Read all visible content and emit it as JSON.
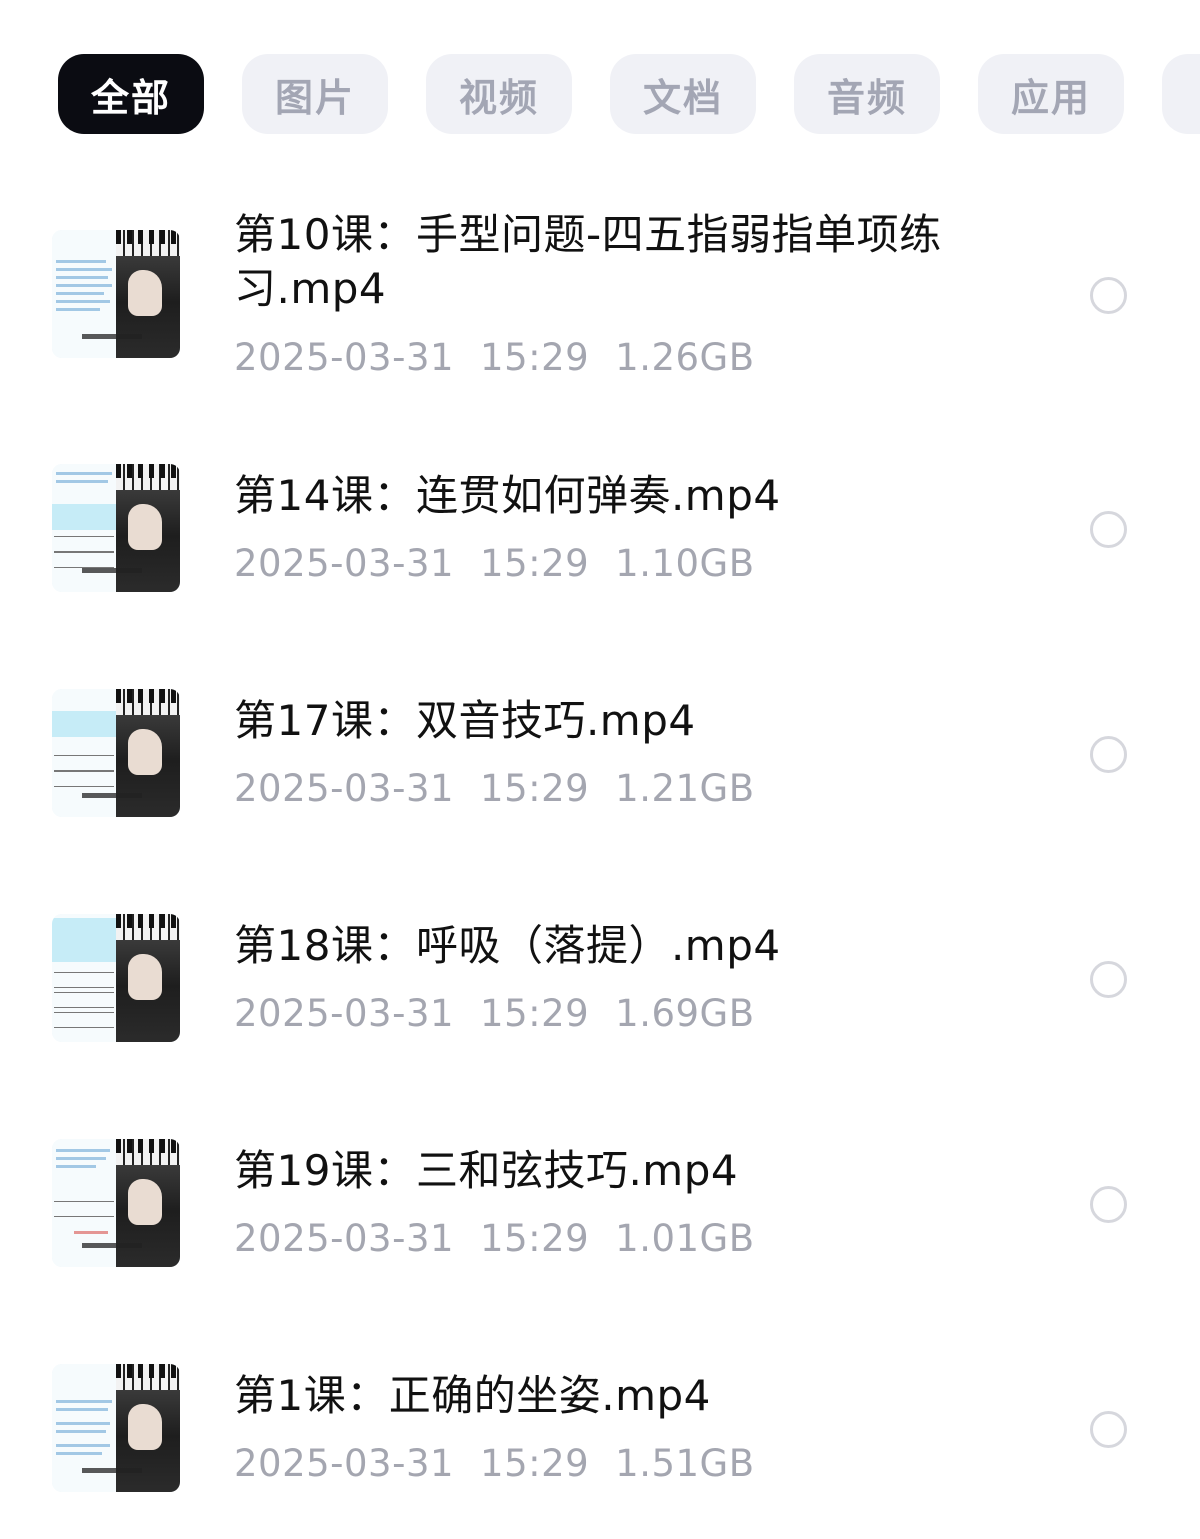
{
  "tabs": [
    {
      "label": "全部",
      "active": true
    },
    {
      "label": "图片",
      "active": false
    },
    {
      "label": "视频",
      "active": false
    },
    {
      "label": "文档",
      "active": false
    },
    {
      "label": "音频",
      "active": false
    },
    {
      "label": "应用",
      "active": false
    }
  ],
  "files": [
    {
      "name": "第10课：手型问题-四五指弱指单项练习.mp4",
      "date": "2025-03-31",
      "time": "15:29",
      "size": "1.26GB",
      "selected": false
    },
    {
      "name": "第14课：连贯如何弹奏.mp4",
      "date": "2025-03-31",
      "time": "15:29",
      "size": "1.10GB",
      "selected": false
    },
    {
      "name": "第17课：双音技巧.mp4",
      "date": "2025-03-31",
      "time": "15:29",
      "size": "1.21GB",
      "selected": false
    },
    {
      "name": "第18课：呼吸（落提）.mp4",
      "date": "2025-03-31",
      "time": "15:29",
      "size": "1.69GB",
      "selected": false
    },
    {
      "name": "第19课：三和弦技巧.mp4",
      "date": "2025-03-31",
      "time": "15:29",
      "size": "1.01GB",
      "selected": false
    },
    {
      "name": "第1课：正确的坐姿.mp4",
      "date": "2025-03-31",
      "time": "15:29",
      "size": "1.51GB",
      "selected": false
    }
  ],
  "colors": {
    "active_tab_bg": "#0b0c12",
    "tab_bg": "#f0f1f6",
    "tab_text": "#a3a6b4",
    "meta_text": "#a4a6b0"
  }
}
